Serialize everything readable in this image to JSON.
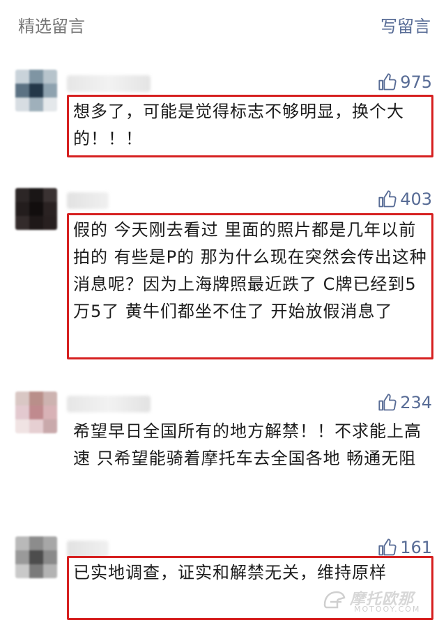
{
  "header": {
    "title": "精选留言",
    "write_label": "写留言"
  },
  "comments": [
    {
      "likes": "975",
      "text": "想多了，可能是觉得标志不够明显，换个大的！！！",
      "highlighted": true,
      "avatar_colors": [
        "#c9d3da",
        "#7f95a3",
        "#b7c4cc",
        "#5c7283",
        "#243849",
        "#8ea2af",
        "#d7dde2",
        "#9fb0bb",
        "#e4e8eb"
      ]
    },
    {
      "likes": "403",
      "text": "假的 今天刚去看过 里面的照片都是几年以前拍的 有些是P的 那为什么现在突然会传出这种消息呢？因为上海牌照最近跌了 C牌已经到5万5了 黄牛们都坐不住了 开始放假消息了",
      "highlighted": true,
      "avatar_colors": [
        "#2c2626",
        "#1a1616",
        "#3a3232",
        "#231d1d",
        "#120e0e",
        "#2a2222",
        "#332b2b",
        "#1e1818",
        "#282020"
      ]
    },
    {
      "likes": "234",
      "text": "希望早日全国所有的地方解禁！！不求能上高速 只希望能骑着摩托车去全国各地 畅通无阻",
      "highlighted": false,
      "avatar_colors": [
        "#d9c7c4",
        "#b98f8a",
        "#cdb3b0",
        "#e3c9cf",
        "#c08a8e",
        "#d8b2b6",
        "#f0e3e3",
        "#e6cfd2",
        "#c9a9ab"
      ]
    },
    {
      "likes": "161",
      "text": "已实地调查，证实和解禁无关，维持原样",
      "highlighted": true,
      "avatar_colors": [
        "#b9b9b9",
        "#8c8c8c",
        "#a7a7a7",
        "#9a9a9a",
        "#4d4d4d",
        "#8a8a8a",
        "#c9c9c9",
        "#7b7b7b",
        "#b3b3b3"
      ]
    }
  ],
  "watermark": {
    "brand": "摩托欧那",
    "sub": "MOTOOY.COM"
  },
  "icons": {
    "like": "thumbs-up-icon"
  },
  "colors": {
    "accent": "#576b95",
    "highlight_border": "#d62020"
  }
}
